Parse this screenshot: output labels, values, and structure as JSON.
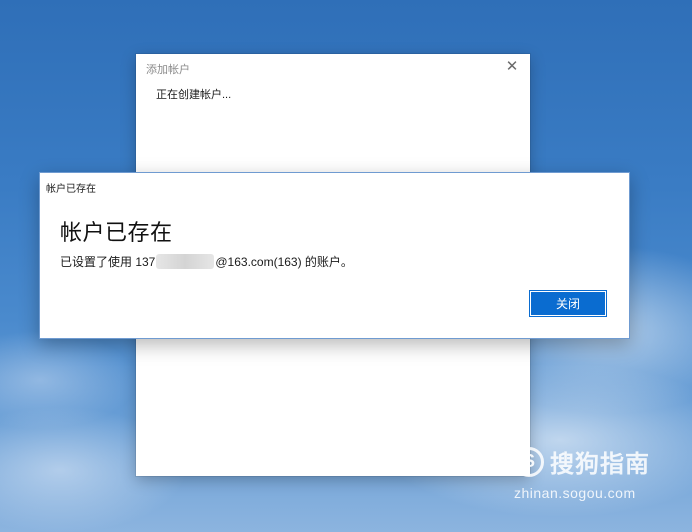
{
  "background_dialog": {
    "title": "添加帐户",
    "status": "正在创建帐户..."
  },
  "dialog": {
    "titlebar": "帐户已存在",
    "heading": "帐户已存在",
    "message_prefix": "已设置了使用 137",
    "message_suffix": "@163.com(163) 的账户。",
    "close_label": "关闭"
  },
  "watermark": {
    "logo_letter": "S",
    "name": "搜狗指南",
    "url": "zhinan.sogou.com"
  },
  "colors": {
    "accent": "#0a6cd0"
  }
}
